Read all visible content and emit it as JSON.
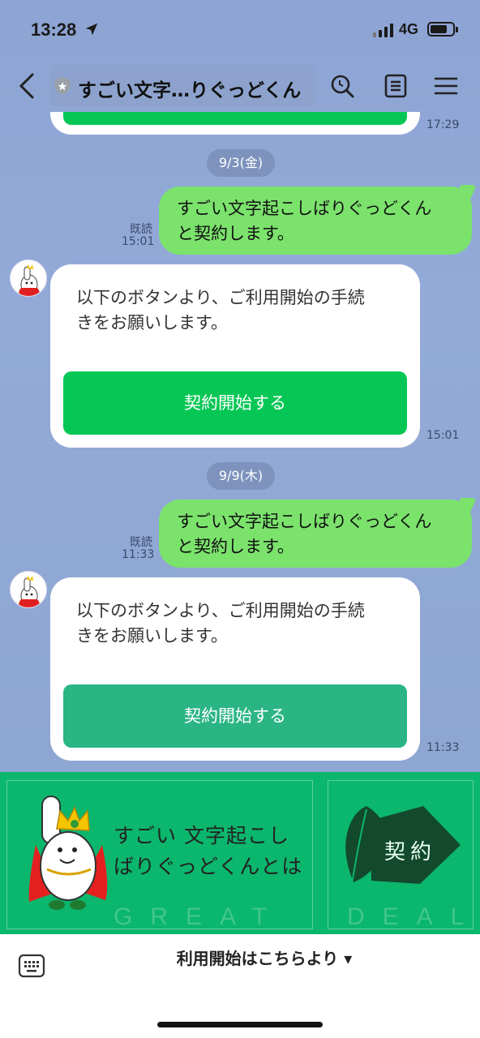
{
  "status_bar": {
    "time": "13:28",
    "network": "4G"
  },
  "header": {
    "title": "すごい文字…りぐっどくん"
  },
  "messages": {
    "date1": "9/3(金)",
    "msg1": {
      "line1": "すごい文字起こしばりぐっどくん",
      "line2": "と契約します。",
      "read": "既読",
      "time": "15:01"
    },
    "bot1": {
      "line1": "以下のボタンより、ご利用開始の手続",
      "line2": "きをお願いします。",
      "button": "契約開始する",
      "time": "15:01"
    },
    "date2": "9/9(木)",
    "msg2": {
      "line1": "すごい文字起こしばりぐっどくん",
      "line2": "と契約します。",
      "read": "既読",
      "time": "11:33"
    },
    "bot2": {
      "line1": "以下のボタンより、ご利用開始の手続",
      "line2": "きをお願いします。",
      "button": "契約開始する",
      "time": "11:33"
    },
    "prev_time": "17:29"
  },
  "rich_menu": {
    "left_line1": "すごい 文字起こし",
    "left_line2": "ばりぐっどくんとは",
    "left_watermark": "GREAT",
    "right_label": "契約",
    "right_watermark": "DEAL"
  },
  "bottom": {
    "menu_label": "利用開始はこちらより ▾"
  },
  "colors": {
    "accent": "#06c755",
    "rich_menu": "#0bb66d",
    "my_bubble": "#7be26c",
    "button_pressed": "#2bb584"
  }
}
